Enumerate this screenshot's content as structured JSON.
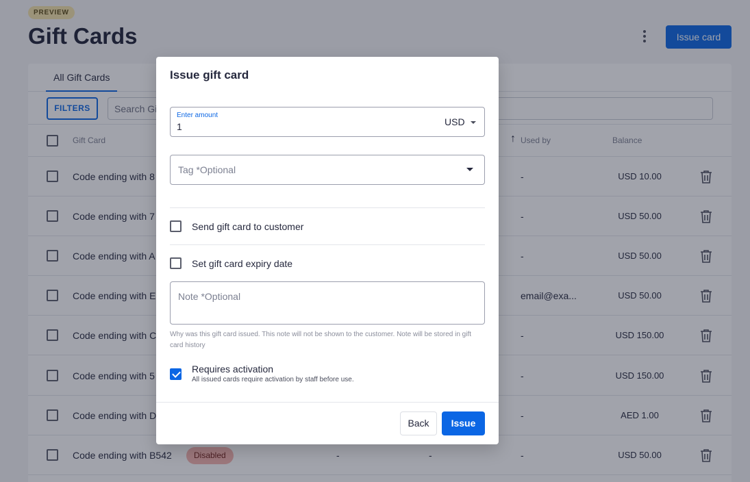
{
  "page": {
    "badge": "PREVIEW",
    "title": "Gift Cards",
    "issue_card_label": "Issue card",
    "more_icon": "more-vertical-icon"
  },
  "tabs": [
    {
      "label": "All Gift Cards",
      "active": true
    }
  ],
  "filters": {
    "button_label": "FILTERS",
    "search_placeholder": "Search Gift Cards..."
  },
  "table": {
    "headers": {
      "gift_card": "Gift Card",
      "used_by": "Used by",
      "balance": "Balance"
    },
    "rows": [
      {
        "name": "Code ending with 8",
        "used_by": "-",
        "balance": "USD 10.00"
      },
      {
        "name": "Code ending with 7",
        "used_by": "-",
        "balance": "USD 50.00"
      },
      {
        "name": "Code ending with A",
        "used_by": "-",
        "balance": "USD 50.00"
      },
      {
        "name": "Code ending with E",
        "used_by": "email@exa...",
        "balance": "USD 50.00"
      },
      {
        "name": "Code ending with C",
        "used_by": "-",
        "balance": "USD 150.00"
      },
      {
        "name": "Code ending with 5",
        "used_by": "-",
        "balance": "USD 150.00"
      },
      {
        "name": "Code ending with D",
        "used_by": "-",
        "balance": "AED 1.00"
      },
      {
        "name": "Code ending with B542",
        "status": "Disabled",
        "col_a": "-",
        "col_b": "-",
        "used_by": "-",
        "balance": "USD 50.00"
      }
    ]
  },
  "dialog": {
    "title": "Issue gift card",
    "amount_label": "Enter amount",
    "amount_value": "1",
    "currency": "USD",
    "tag_placeholder": "Tag *Optional",
    "send_to_customer_label": "Send gift card to customer",
    "expiry_label": "Set gift card expiry date",
    "note_placeholder": "Note *Optional",
    "note_help": "Why was this gift card issued. This note will not be shown to the customer. Note will be stored in gift card history",
    "requires_activation_title": "Requires activation",
    "requires_activation_desc": "All issued cards require activation by staff before use.",
    "requires_activation_checked": true,
    "back_label": "Back",
    "issue_label": "Issue"
  },
  "colors": {
    "accent": "#0b66e4",
    "disabled_pill": "#f7b4ae",
    "preview_badge": "#f4e3a9"
  }
}
